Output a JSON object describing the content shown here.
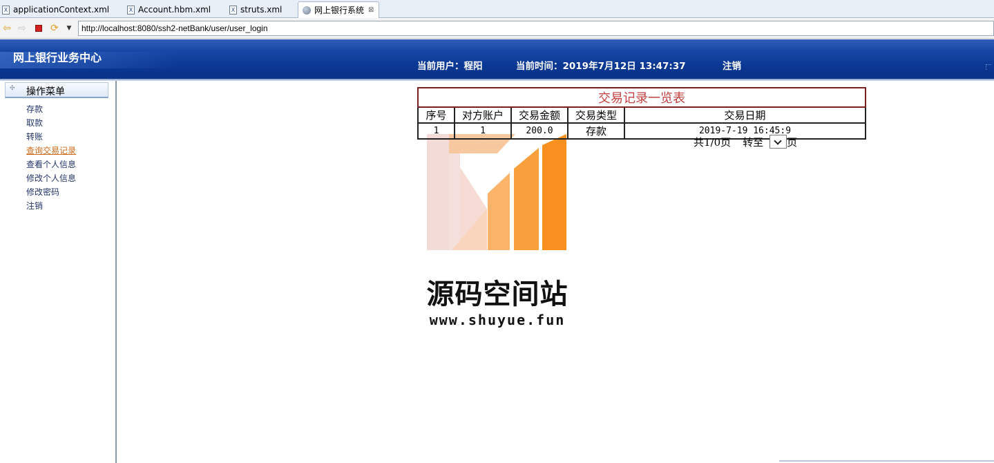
{
  "tabs": [
    {
      "label": "applicationContext.xml",
      "icon": "xml-file-icon",
      "active": false
    },
    {
      "label": "Account.hbm.xml",
      "icon": "xml-file-icon",
      "active": false
    },
    {
      "label": "struts.xml",
      "icon": "xml-file-icon",
      "active": false
    },
    {
      "label": "网上银行系统",
      "icon": "globe-icon",
      "active": true
    }
  ],
  "tab_icon_glyph": "X",
  "tab_close_glyph": "⊠",
  "toolbar": {
    "url": "http://localhost:8080/ssh2-netBank/user/user_login",
    "buttons": [
      "back-arrow-icon",
      "forward-arrow-icon",
      "stop-icon",
      "refresh-icon",
      "dropdown-arrow-icon"
    ]
  },
  "header": {
    "site_title": "网上银行业务中心",
    "current_user": "当前用户：程阳",
    "current_time": "当前时间：2019年7月12日 13:47:37",
    "logout": "注销"
  },
  "sidebar": {
    "heading": "操作菜单",
    "items": [
      {
        "label": "存款",
        "current": false
      },
      {
        "label": "取款",
        "current": false
      },
      {
        "label": "转账",
        "current": false
      },
      {
        "label": "查询交易记录",
        "current": true
      },
      {
        "label": "查看个人信息",
        "current": false
      },
      {
        "label": "修改个人信息",
        "current": false
      },
      {
        "label": "修改密码",
        "current": false
      },
      {
        "label": "注销",
        "current": false
      }
    ]
  },
  "table": {
    "caption": "交易记录一览表",
    "columns": [
      "序号",
      "对方账户",
      "交易金额",
      "交易类型",
      "交易日期"
    ],
    "rows": [
      [
        "1",
        "1",
        "200.0",
        "存款",
        "2019-7-19 16:45:9"
      ]
    ]
  },
  "pager": {
    "summary": "共1/0页",
    "goto_prefix": "转至",
    "goto_suffix": "页",
    "selected_page": ""
  },
  "watermark": {
    "title": "源码空间站",
    "url": "www.shuyue.fun"
  },
  "colors": {
    "header_blue": "#0b3894",
    "caption_red": "#c24040",
    "menu_link": "#22356a",
    "menu_current": "#cc6a1a",
    "logo_orange": "#f7901e"
  }
}
